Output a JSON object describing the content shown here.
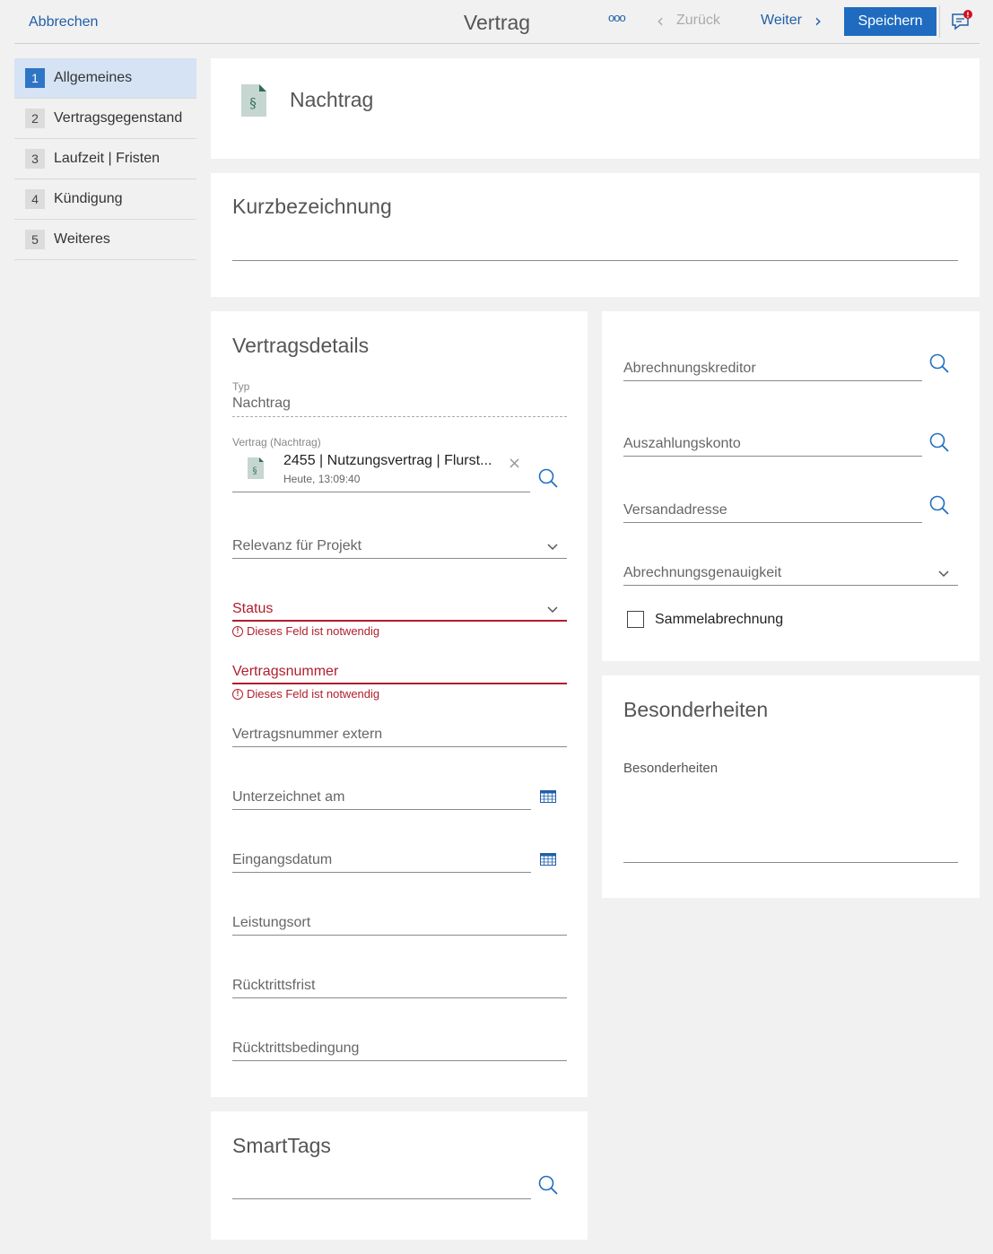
{
  "topbar": {
    "cancel": "Abbrechen",
    "title": "Vertrag",
    "more": "ooo",
    "back": "Zurück",
    "next": "Weiter",
    "save": "Speichern",
    "notification_badge": "!"
  },
  "sidebar": {
    "items": [
      {
        "num": "1",
        "label": "Allgemeines"
      },
      {
        "num": "2",
        "label": "Vertragsgegenstand"
      },
      {
        "num": "3",
        "label": "Laufzeit | Fristen"
      },
      {
        "num": "4",
        "label": "Kündigung"
      },
      {
        "num": "5",
        "label": "Weiteres"
      }
    ]
  },
  "header": {
    "title": "Nachtrag",
    "doc_icon_glyph": "§"
  },
  "kurz": {
    "label": "Kurzbezeichnung"
  },
  "details": {
    "title": "Vertragsdetails",
    "typ_label": "Typ",
    "typ_value": "Nachtrag",
    "vertrag_label": "Vertrag (Nachtrag)",
    "vertrag_value": "2455 | Nutzungsvertrag | Flurst...",
    "vertrag_time": "Heute, 13:09:40",
    "relevanz": "Relevanz für Projekt",
    "status": "Status",
    "required_msg": "Dieses Feld ist notwendig",
    "vertragsnummer": "Vertragsnummer",
    "vertragsnummer_extern": "Vertragsnummer extern",
    "unterzeichnet": "Unterzeichnet am",
    "eingangsdatum": "Eingangsdatum",
    "leistungsort": "Leistungsort",
    "ruecktrittsfrist": "Rücktrittsfrist",
    "ruecktrittsbedingung": "Rücktrittsbedingung"
  },
  "right": {
    "abrechnungskreditor": "Abrechnungskreditor",
    "auszahlungskonto": "Auszahlungskonto",
    "versandadresse": "Versandadresse",
    "abrechnungsgenauigkeit": "Abrechnungsgenauigkeit",
    "sammelabrechnung": "Sammelabrechnung"
  },
  "besonderheiten": {
    "title": "Besonderheiten",
    "label": "Besonderheiten"
  },
  "smarttags": {
    "title": "SmartTags"
  },
  "colors": {
    "accent": "#1e6bc0",
    "error": "#b01e2c",
    "nav_active": "#d5e3f5"
  }
}
